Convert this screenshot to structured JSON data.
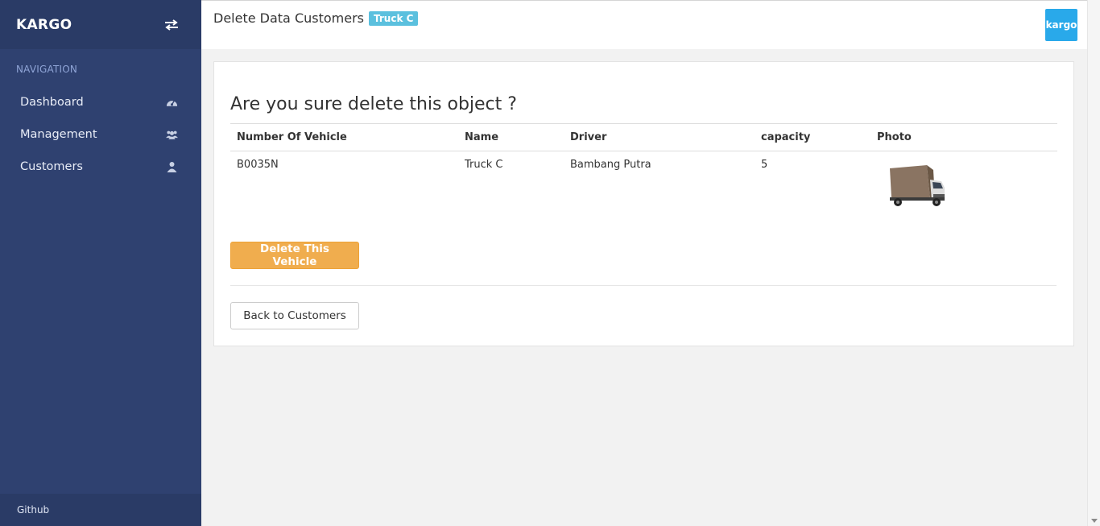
{
  "sidebar": {
    "brand": "KARGO",
    "nav_heading": "NAVIGATION",
    "items": [
      {
        "label": "Dashboard",
        "icon": "dashboard-icon"
      },
      {
        "label": "Management",
        "icon": "users-icon"
      },
      {
        "label": "Customers",
        "icon": "user-icon"
      }
    ],
    "footer": "Github"
  },
  "header": {
    "title": "Delete Data Customers",
    "badge": "Truck C",
    "logo_text": "kargo"
  },
  "main": {
    "question": "Are you sure delete this object ?",
    "table": {
      "headers": [
        "Number Of Vehicle",
        "Name",
        "Driver",
        "capacity",
        "Photo"
      ],
      "row": {
        "number": "B0035N",
        "name": "Truck C",
        "driver": "Bambang Putra",
        "capacity": "5",
        "photo_icon": "truck-photo"
      }
    },
    "delete_button": "Delete This Vehicle",
    "back_button": "Back to Customers"
  },
  "colors": {
    "sidebar": "#2f4170",
    "sidebar_header": "#2a3b66",
    "badge": "#5bc0de",
    "logo": "#29a9ea",
    "warning": "#f0ad4e"
  }
}
